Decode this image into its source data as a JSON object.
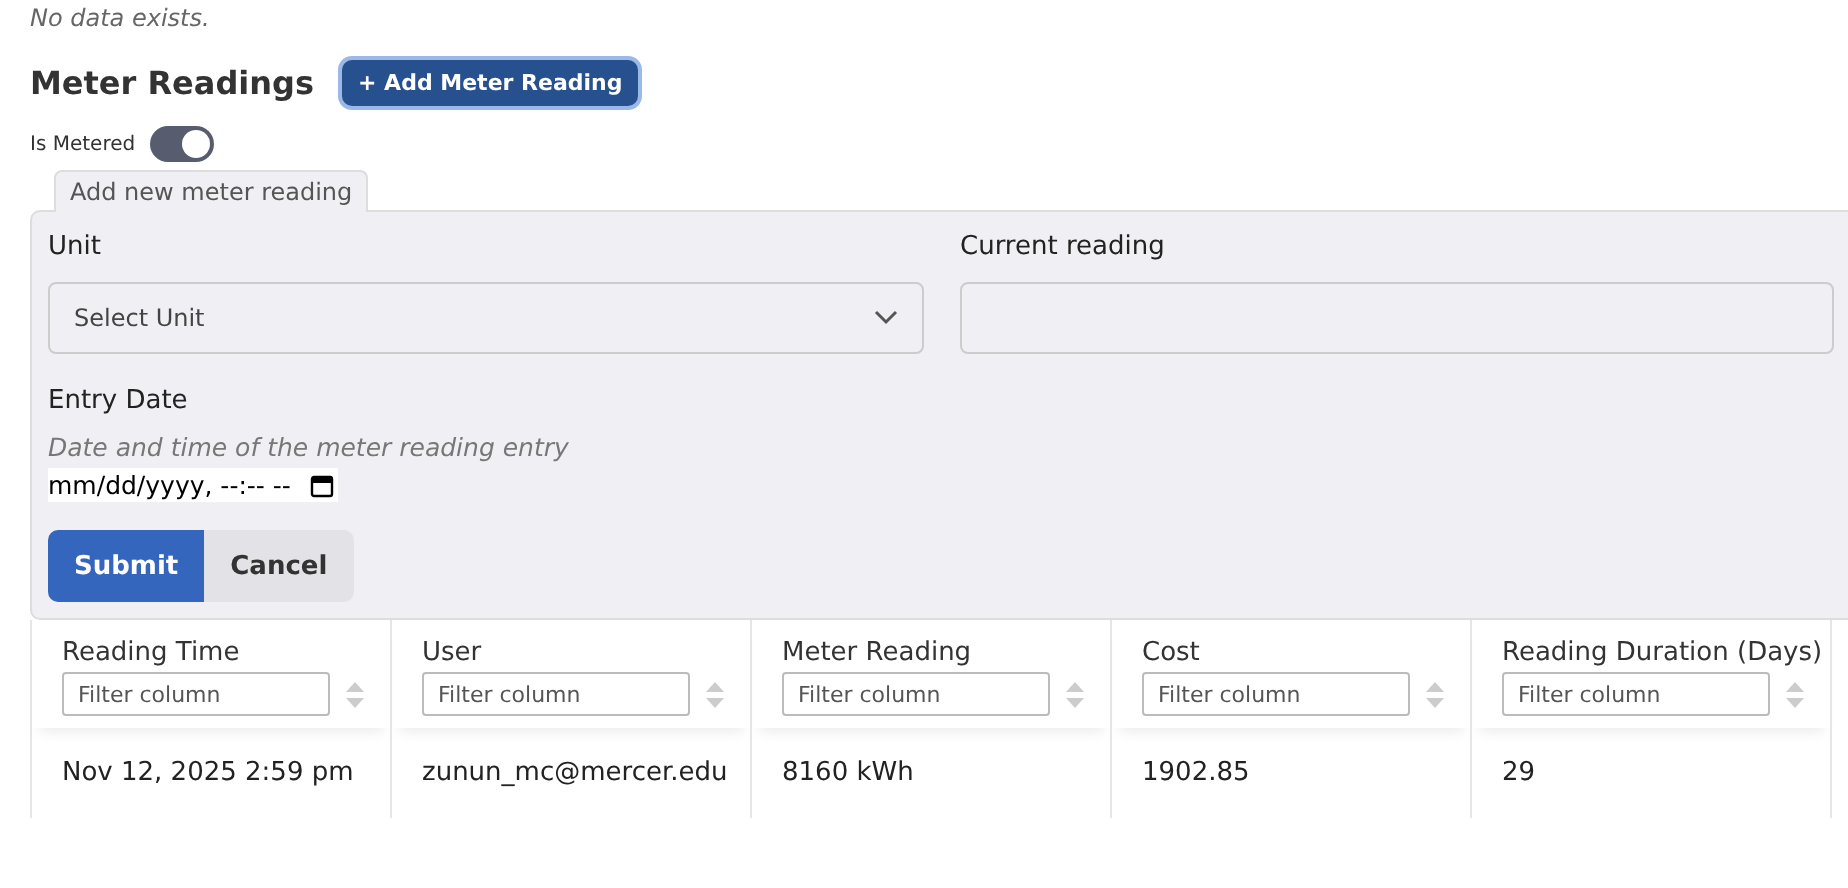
{
  "empty_message": "No data exists.",
  "section": {
    "title": "Meter Readings",
    "add_button": "+ Add Meter Reading"
  },
  "toggle": {
    "label": "Is Metered",
    "on": true
  },
  "form": {
    "legend": "Add new meter reading",
    "unit": {
      "label": "Unit",
      "placeholder": "Select Unit"
    },
    "current_reading": {
      "label": "Current reading"
    },
    "entry_date": {
      "label": "Entry Date",
      "hint": "Date and time of the meter reading entry",
      "placeholder": "mm/dd/yyyy, --:-- --"
    },
    "buttons": [
      "Submit",
      "Cancel"
    ]
  },
  "table": {
    "columns": [
      {
        "title": "Reading Time",
        "filter_placeholder": "Filter column"
      },
      {
        "title": "User",
        "filter_placeholder": "Filter column"
      },
      {
        "title": "Meter Reading",
        "filter_placeholder": "Filter column"
      },
      {
        "title": "Cost",
        "filter_placeholder": "Filter column"
      },
      {
        "title": "Reading Duration (Days)",
        "filter_placeholder": "Filter column"
      }
    ],
    "rows": [
      [
        "Nov 12, 2025 2:59 pm",
        "zunun_mc@mercer.edu",
        "8160 kWh",
        "1902.85",
        "29"
      ]
    ]
  }
}
